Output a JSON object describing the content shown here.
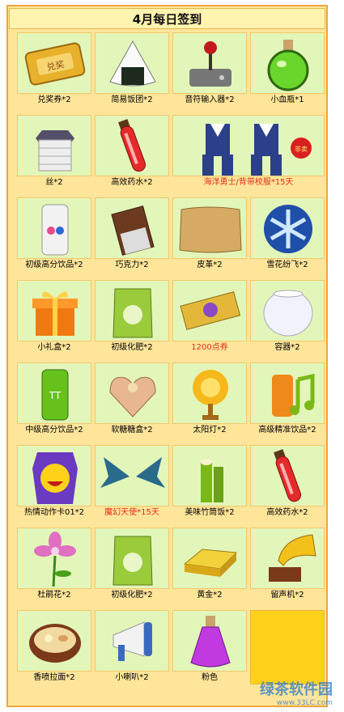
{
  "title": "4月每日签到",
  "rows": [
    [
      {
        "name": "兑奖券*2",
        "icon": "ticket-icon"
      },
      {
        "name": "简易饭团*2",
        "icon": "rice-ball-icon"
      },
      {
        "name": "音符输入器*2",
        "icon": "joystick-icon"
      },
      {
        "name": "小血瓶*1",
        "icon": "potion-flask-icon"
      }
    ],
    [
      {
        "name": "丝*2",
        "icon": "silk-spool-icon"
      },
      {
        "name": "高效药水*2",
        "icon": "red-vial-icon"
      },
      {
        "name": "海洋勇士/背带校服*15天",
        "icon": "uniform-icon",
        "red": true,
        "wide": true,
        "badge": "非卖"
      }
    ],
    [
      {
        "name": "初级高分饮品*2",
        "icon": "drink-can-icon"
      },
      {
        "name": "巧克力*2",
        "icon": "chocolate-icon"
      },
      {
        "name": "皮革*2",
        "icon": "leather-icon"
      },
      {
        "name": "雪花纷飞*2",
        "icon": "snowflake-icon"
      }
    ],
    [
      {
        "name": "小礼盒*2",
        "icon": "gift-box-icon"
      },
      {
        "name": "初级化肥*2",
        "icon": "fertilizer-bag-icon"
      },
      {
        "name": "1200点券",
        "icon": "coupon-icon",
        "red": true
      },
      {
        "name": "容器*2",
        "icon": "glass-bowl-icon"
      }
    ],
    [
      {
        "name": "中级高分饮品*2",
        "icon": "green-can-icon"
      },
      {
        "name": "软糖糖盒*2",
        "icon": "heart-box-icon"
      },
      {
        "name": "太阳灯*2",
        "icon": "sun-lamp-icon"
      },
      {
        "name": "高级精准饮品*2",
        "icon": "music-drink-icon"
      }
    ],
    [
      {
        "name": "热情动作卡01*2",
        "icon": "emote-card-icon"
      },
      {
        "name": "魔幻天使*15天",
        "icon": "wings-icon",
        "red": true
      },
      {
        "name": "美味竹筒饭*2",
        "icon": "bamboo-rice-icon"
      },
      {
        "name": "高效药水*2",
        "icon": "red-vial-icon"
      }
    ],
    [
      {
        "name": "杜鹃花*2",
        "icon": "azalea-icon"
      },
      {
        "name": "初级化肥*2",
        "icon": "fertilizer-bag-icon"
      },
      {
        "name": "黄金*2",
        "icon": "gold-bar-icon"
      },
      {
        "name": "留声机*2",
        "icon": "gramophone-icon"
      }
    ],
    [
      {
        "name": "香喷拉面*2",
        "icon": "ramen-icon"
      },
      {
        "name": "小喇叭*2",
        "icon": "megaphone-icon"
      },
      {
        "name": "粉色",
        "icon": "pink-potion-icon"
      },
      {
        "name": "",
        "icon": "",
        "empty": true
      }
    ]
  ],
  "watermark": {
    "brand": "绿茶软件园",
    "url": "www.33LC.com"
  },
  "colors": {
    "tile": "#e3f6b9",
    "board": "#ffe59a",
    "border": "#f0a43a",
    "red_text": "#e52d1d"
  }
}
